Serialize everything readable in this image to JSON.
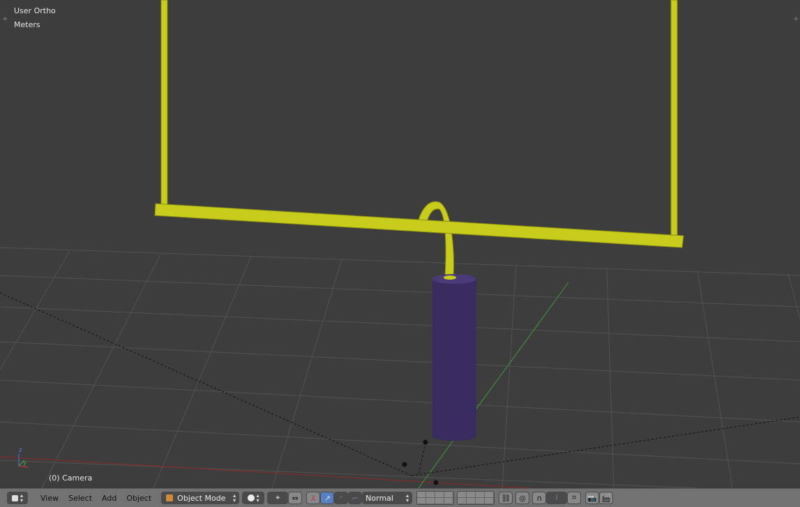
{
  "viewport": {
    "view_name": "User Ortho",
    "units": "Meters",
    "object_label": "(0) Camera"
  },
  "header": {
    "menus": [
      "View",
      "Select",
      "Add",
      "Object"
    ],
    "mode": "Object Mode",
    "pivot_orientation": "Normal"
  },
  "colors": {
    "background": "#3d3d3d",
    "goalpost": "#c8cc1a",
    "pad": "#3a2c60",
    "header": "#727272"
  }
}
